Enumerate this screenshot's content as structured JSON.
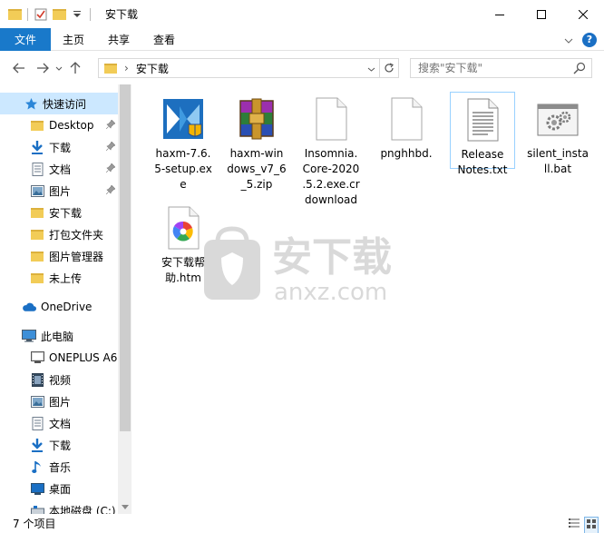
{
  "window": {
    "title": "安下载",
    "minimize_icon": "minimize-icon",
    "maximize_icon": "maximize-icon",
    "close_icon": "close-icon"
  },
  "ribbon": {
    "tabs": [
      "文件",
      "主页",
      "共享",
      "查看"
    ]
  },
  "address": {
    "path_label": "安下载",
    "search_placeholder": "搜索\"安下载\""
  },
  "nav": {
    "quick_access": {
      "label": "快速访问",
      "items": [
        {
          "label": "Desktop",
          "icon": "folder-icon",
          "pinned": true
        },
        {
          "label": "下载",
          "icon": "download-icon",
          "pinned": true
        },
        {
          "label": "文档",
          "icon": "document-icon",
          "pinned": true
        },
        {
          "label": "图片",
          "icon": "picture-icon",
          "pinned": true
        },
        {
          "label": "安下载",
          "icon": "folder-icon",
          "pinned": false
        },
        {
          "label": "打包文件夹",
          "icon": "folder-icon",
          "pinned": false
        },
        {
          "label": "图片管理器",
          "icon": "folder-icon",
          "pinned": false
        },
        {
          "label": "未上传",
          "icon": "folder-icon",
          "pinned": false
        }
      ]
    },
    "onedrive": "OneDrive",
    "this_pc": {
      "label": "此电脑",
      "items": [
        {
          "label": "ONEPLUS A6",
          "icon": "phone-icon"
        },
        {
          "label": "视频",
          "icon": "video-icon"
        },
        {
          "label": "图片",
          "icon": "picture-icon"
        },
        {
          "label": "文档",
          "icon": "document-icon"
        },
        {
          "label": "下载",
          "icon": "download-icon"
        },
        {
          "label": "音乐",
          "icon": "music-icon"
        },
        {
          "label": "桌面",
          "icon": "desktop-icon"
        },
        {
          "label": "本地磁盘 (C:)",
          "icon": "drive-icon"
        }
      ]
    }
  },
  "files": [
    {
      "name": "haxm-7.6.5-setup.exe",
      "lines": [
        "haxm-7.6.",
        "5-setup.ex",
        "e"
      ],
      "icon": "installer-icon"
    },
    {
      "name": "haxm-windows_v7_6_5.zip",
      "lines": [
        "haxm-win",
        "dows_v7_6",
        "_5.zip"
      ],
      "icon": "winrar-archive-icon"
    },
    {
      "name": "Insomnia.Core-2020.5.2.exe.crdownload",
      "lines": [
        "Insomnia.",
        "Core-2020",
        ".5.2.exe.cr",
        "download"
      ],
      "icon": "blank-file-icon"
    },
    {
      "name": "pnghhbd.",
      "lines": [
        "pnghhbd."
      ],
      "icon": "blank-file-icon"
    },
    {
      "name": "Release Notes.txt",
      "lines": [
        "Release",
        "Notes.txt"
      ],
      "icon": "text-file-icon"
    },
    {
      "name": "silent_install.bat",
      "lines": [
        "silent_insta",
        "ll.bat"
      ],
      "icon": "batch-file-icon"
    },
    {
      "name": "安下载帮助.htm",
      "lines": [
        "安下载帮",
        "助.htm"
      ],
      "icon": "html-file-icon"
    }
  ],
  "status": {
    "count": "7 个项目"
  },
  "colors": {
    "accent": "#1979ca",
    "selection": "#cce8ff",
    "folder": "#f2cc57"
  }
}
